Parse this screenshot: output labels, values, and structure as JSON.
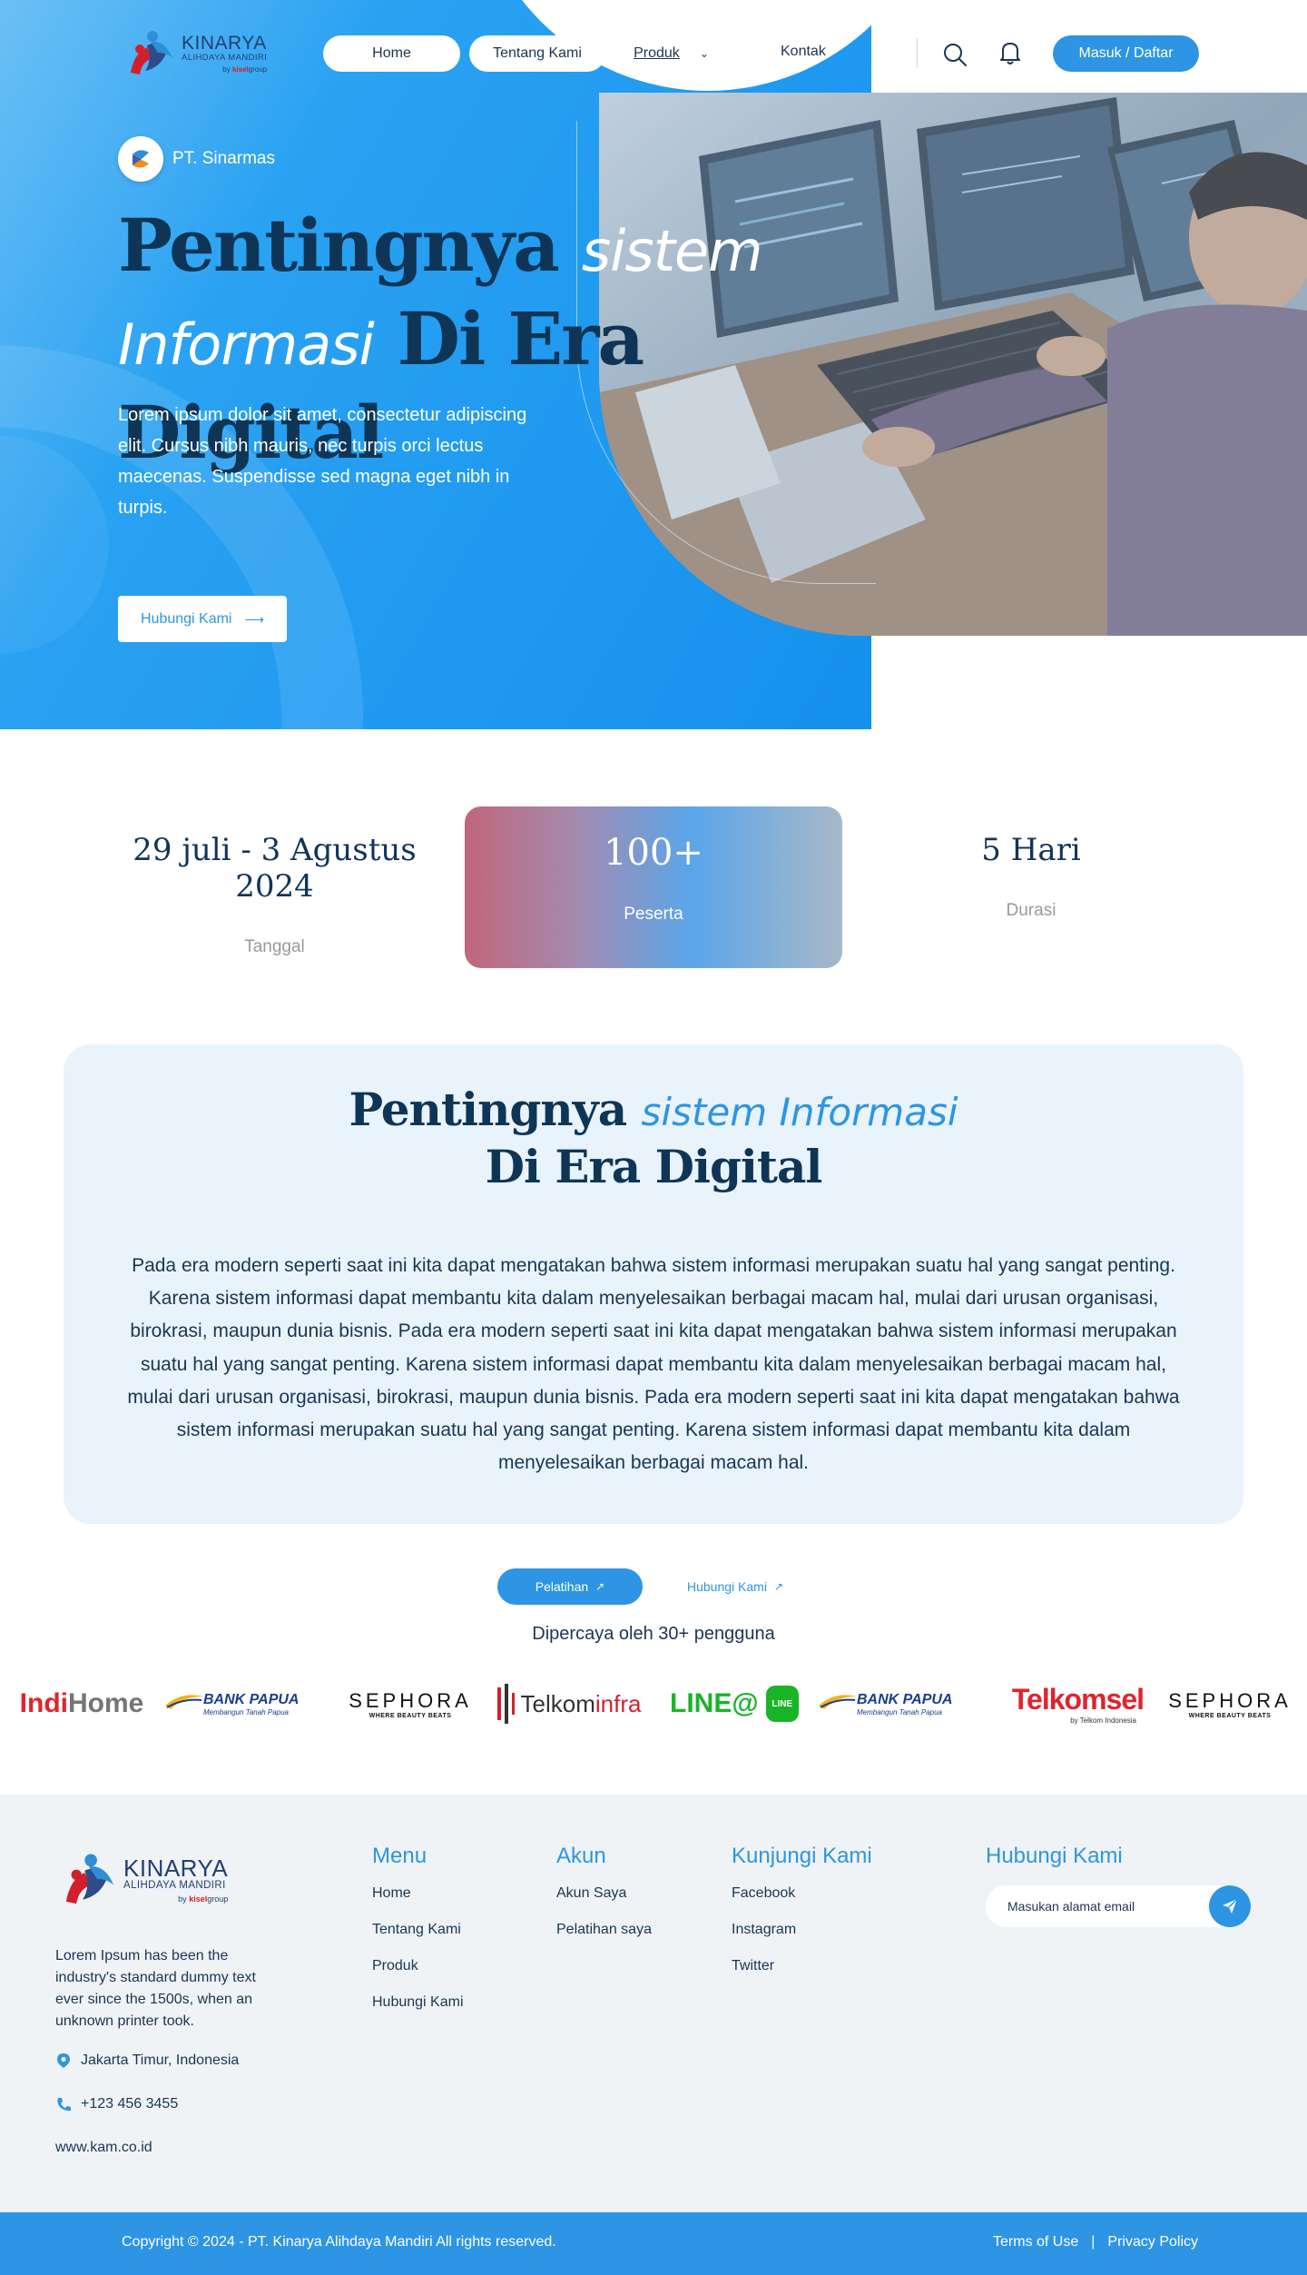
{
  "brand": {
    "logo_main": "KINARYA",
    "logo_sub": "ALIHDAYA MANDIRI",
    "logo_by": "by",
    "logo_group": "kisel",
    "logo_group_suffix": "group"
  },
  "nav": {
    "home": "Home",
    "about": "Tentang Kami",
    "produk": "Produk",
    "kontak": "Kontak",
    "login": "Masuk / Daftar"
  },
  "hero": {
    "company": "PT. Sinarmas",
    "title_part1": "Pentingnya ",
    "title_script1": "sistem",
    "title_script2": "Informasi",
    "title_part2": " Di Era Digital",
    "description": "Lorem ipsum dolor sit amet, consectetur adipiscing elit. Cursus nibh mauris, nec turpis orci lectus maecenas. Suspendisse sed magna eget nibh in turpis.",
    "cta": "Hubungi Kami",
    "cta_arrow": "⟶"
  },
  "stats": [
    {
      "value": "29 juli - 3 Agustus 2024",
      "label": "Tanggal"
    },
    {
      "value": "100+",
      "label": "Peserta"
    },
    {
      "value": "5 Hari",
      "label": "Durasi"
    }
  ],
  "article": {
    "title_part1": "Pentingnya ",
    "title_script": "sistem Informasi",
    "title_line2": "Di Era Digital",
    "body": "Pada era modern seperti saat ini kita dapat mengatakan bahwa sistem informasi merupakan suatu hal yang sangat penting. Karena sistem informasi dapat membantu kita dalam menyelesaikan berbagai macam hal, mulai dari urusan organisasi, birokrasi, maupun dunia bisnis. Pada era modern seperti saat ini kita dapat mengatakan bahwa sistem informasi merupakan suatu hal yang sangat penting. Karena sistem informasi dapat membantu kita dalam menyelesaikan berbagai macam hal, mulai dari urusan organisasi, birokrasi, maupun dunia bisnis. Pada era modern seperti saat ini kita dapat mengatakan bahwa sistem informasi merupakan suatu hal yang sangat penting. Karena sistem informasi dapat membantu kita dalam menyelesaikan berbagai macam hal."
  },
  "cta": {
    "training": "Pelatihan",
    "contact": "Hubungi Kami",
    "ext_icon": "↗"
  },
  "clients": {
    "trusted_text": "Dipercaya oleh 30+ pengguna",
    "indihome_a": "Indi",
    "indihome_b": "Home",
    "papua_main": "BANK PAPUA",
    "papua_sub": "Membangun Tanah Papua",
    "sephora_main": "SEPHORA",
    "sephora_sub": "WHERE BEAUTY BEATS",
    "telkom_a": "Telkom",
    "telkom_b": "infra",
    "line": "LINE@",
    "line_badge": "LINE",
    "telkomsel": "Telkomsel",
    "telkomsel_sub": "by Telkom Indonesia"
  },
  "footer": {
    "description": "Lorem Ipsum has been the industry's standard dummy text ever since the 1500s, when an unknown printer took.",
    "address": "Jakarta Timur, Indonesia",
    "phone": "+123 456 3455",
    "website": "www.kam.co.id",
    "menu_title": "Menu",
    "menu": [
      "Home",
      "Tentang Kami",
      "Produk",
      "Hubungi Kami"
    ],
    "account_title": "Akun",
    "account": [
      "Akun Saya",
      "Pelatihan saya"
    ],
    "visit_title": "Kunjungi Kami",
    "visit": [
      "Facebook",
      "Instagram",
      "Twitter"
    ],
    "contact_title": "Hubungi Kami",
    "email_placeholder": "Masukan alamat email",
    "copyright": "Copyright © 2024 - PT. Kinarya Alihdaya Mandiri All rights reserved.",
    "terms": "Terms of Use",
    "separator": "|",
    "privacy": "Privacy Policy"
  },
  "colors": {
    "primary": "#2d95e3",
    "navy": "#0f3556",
    "hero_gradient_start": "#6cc0f5",
    "hero_gradient_end": "#1491ee",
    "article_bg": "#e8f3fc",
    "footer_bg": "#eff3f6"
  }
}
